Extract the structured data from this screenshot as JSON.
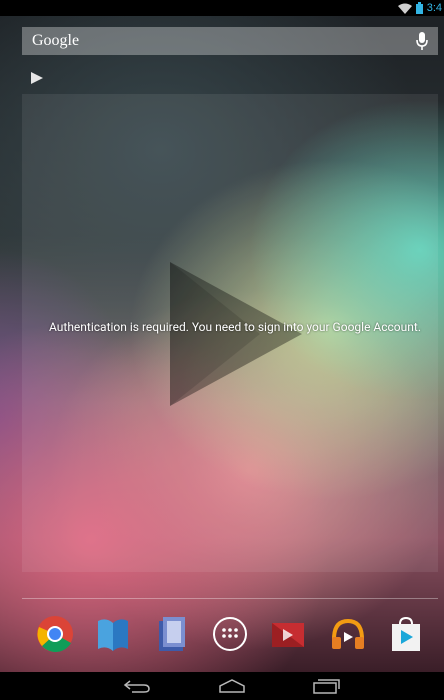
{
  "status_bar": {
    "time": "3:4",
    "icons": [
      "wifi-icon",
      "battery-icon"
    ]
  },
  "search": {
    "logo": "Google",
    "icon": "mic-icon"
  },
  "widget": {
    "message": "Authentication is required. You need to sign into your Google Account.",
    "icon": "play-store-logo"
  },
  "dock": {
    "apps": [
      {
        "name": "chrome",
        "icon": "chrome-icon"
      },
      {
        "name": "play-books",
        "icon": "play-books-icon"
      },
      {
        "name": "play-magazines",
        "icon": "play-magazines-icon"
      },
      {
        "name": "all-apps",
        "icon": "all-apps-icon"
      },
      {
        "name": "play-movies",
        "icon": "play-movies-icon"
      },
      {
        "name": "play-music",
        "icon": "play-music-icon"
      },
      {
        "name": "play-store",
        "icon": "play-store-icon"
      }
    ]
  },
  "nav": {
    "buttons": [
      "back-icon",
      "home-icon",
      "recents-icon"
    ]
  },
  "colors": {
    "accent": "#33b5e5",
    "status_bar": "#000000"
  }
}
